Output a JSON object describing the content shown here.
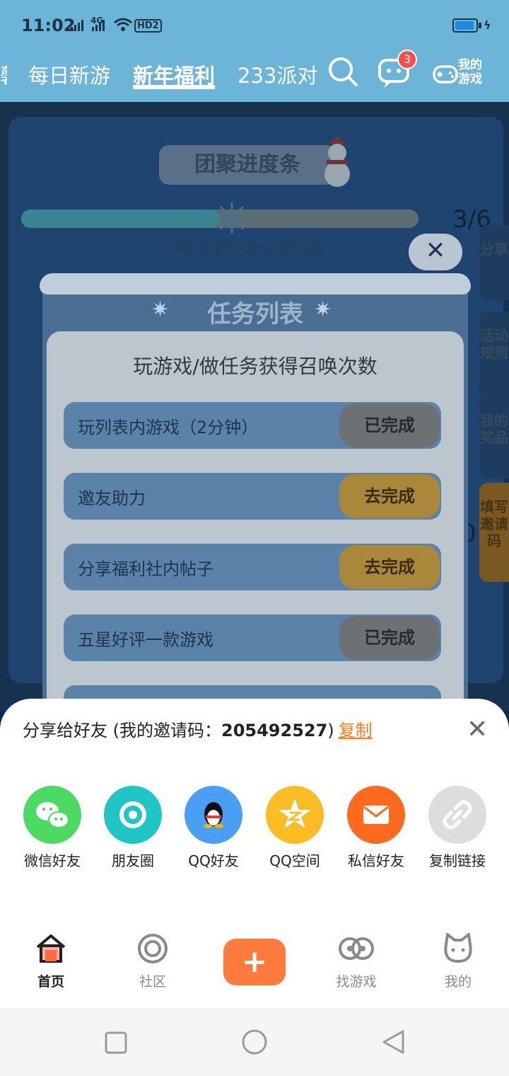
{
  "status_bar": {
    "time": "11:02",
    "net_label": "4G",
    "hd_label": "HD2"
  },
  "top_nav": {
    "tabs": [
      {
        "label": "每日新游"
      },
      {
        "label": "新年福利",
        "active": true
      },
      {
        "label": "233派对"
      }
    ],
    "message_badge": "3",
    "my_games_label": "我的游戏"
  },
  "event": {
    "title": "团聚进度条",
    "progress": {
      "current": 3,
      "total": 6,
      "text": "3/6"
    },
    "note": "团聚完成即可随心选择奖励",
    "side_tabs": [
      "分享",
      "活动规则",
      "我的奖品",
      "填写邀请码"
    ],
    "partial_char": "0"
  },
  "task_modal": {
    "title": "任务列表",
    "subtitle": "玩游戏/做任务获得召唤次数",
    "tasks": [
      {
        "name": "玩列表内游戏（2分钟）",
        "status": "已完成"
      },
      {
        "name": "邀友助力",
        "status": "去完成"
      },
      {
        "name": "分享福利社内帖子",
        "status": "去完成"
      },
      {
        "name": "五星好评一款游戏",
        "status": "已完成"
      }
    ]
  },
  "share_sheet": {
    "title_prefix": "分享给好友 (我的邀请码：",
    "invite_code": "205492527",
    "title_suffix": ")",
    "copy_label": "复制",
    "options": [
      {
        "label": "微信好友",
        "icon": "wechat-icon",
        "color": "#4cd964"
      },
      {
        "label": "朋友圈",
        "icon": "moments-icon",
        "color": "#20c5c5"
      },
      {
        "label": "QQ好友",
        "icon": "qq-icon",
        "color": "#4a9ff5"
      },
      {
        "label": "QQ空间",
        "icon": "qzone-icon",
        "color": "#fbbd23"
      },
      {
        "label": "私信好友",
        "icon": "mail-icon",
        "color": "#ff6a1f"
      },
      {
        "label": "复制链接",
        "icon": "link-icon",
        "color": "#dddddd"
      }
    ]
  },
  "bottom_nav": {
    "items": [
      {
        "label": "首页",
        "active": true
      },
      {
        "label": "社区"
      },
      {
        "label": "找游戏"
      },
      {
        "label": "我的"
      }
    ],
    "plus_label": "+"
  },
  "colors": {
    "accent": "#ff7a1a",
    "topbar": "#6cb5d8"
  }
}
